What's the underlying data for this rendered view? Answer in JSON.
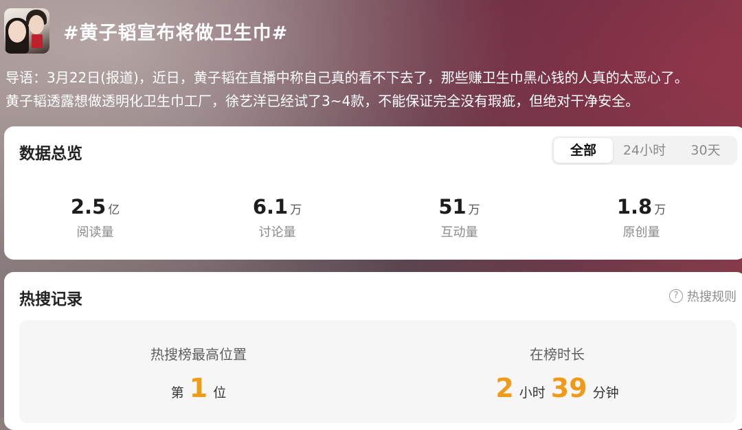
{
  "topic": {
    "title": "#黄子韬宣布将做卫生巾#",
    "avatar_icon": "avatar-photo"
  },
  "lead": {
    "line1": "导语：3月22日(报道)，近日，黄子韬在直播中称自己真的看不下去了，那些赚卫生巾黑心钱的人真的太恶心了。",
    "line2": "黄子韬透露想做透明化卫生巾工厂，徐艺洋已经试了3~4款，不能保证完全没有瑕疵，但绝对干净安全。"
  },
  "overview": {
    "title": "数据总览",
    "tabs": [
      "全部",
      "24小时",
      "30天"
    ],
    "active_tab": "全部",
    "stats": [
      {
        "value": "2.5",
        "unit": "亿",
        "label": "阅读量"
      },
      {
        "value": "6.1",
        "unit": "万",
        "label": "讨论量"
      },
      {
        "value": "51",
        "unit": "万",
        "label": "互动量"
      },
      {
        "value": "1.8",
        "unit": "万",
        "label": "原创量"
      }
    ]
  },
  "hot": {
    "title": "热搜记录",
    "rules_label": "热搜规则",
    "rules_icon": "question-circle-icon",
    "best_rank": {
      "heading": "热搜榜最高位置",
      "prefix": "第",
      "value": "1",
      "suffix": "位"
    },
    "duration": {
      "heading": "在榜时长",
      "hours": "2",
      "hours_unit": "小时",
      "minutes": "39",
      "minutes_unit": "分钟"
    }
  },
  "colors": {
    "accent": "#f09a1a",
    "card": "#ffffff"
  }
}
